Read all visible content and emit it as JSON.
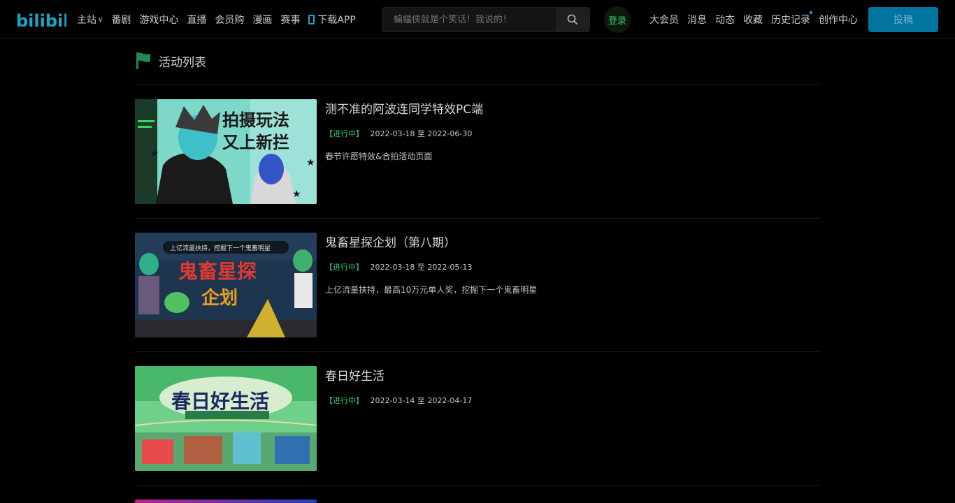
{
  "header": {
    "logo_text": "bilibili",
    "nav": [
      {
        "label": "主站"
      },
      {
        "label": "番剧"
      },
      {
        "label": "游戏中心"
      },
      {
        "label": "直播"
      },
      {
        "label": "会员购"
      },
      {
        "label": "漫画"
      },
      {
        "label": "赛事"
      },
      {
        "label": "下载APP"
      }
    ],
    "search_placeholder": "蝙蝠侠就是个笑话！我说的！",
    "login_label": "登录",
    "right_nav": [
      {
        "label": "大会员"
      },
      {
        "label": "消息"
      },
      {
        "label": "动态"
      },
      {
        "label": "收藏"
      },
      {
        "label": "历史记录"
      },
      {
        "label": "创作中心"
      }
    ],
    "post_label": "投稿"
  },
  "section": {
    "title": "活动列表"
  },
  "activities": [
    {
      "title": "测不准的阿波连同学特效PC端",
      "status": "【进行中】",
      "date_range": "2022-03-18 至 2022-06-30",
      "description": "春节许愿特效&合拍活动页面",
      "thumb_text": [
        "拍摄玩法",
        "又上新拦"
      ]
    },
    {
      "title": "鬼畜星探企划（第八期）",
      "status": "【进行中】",
      "date_range": "2022-03-18 至 2022-05-13",
      "description": "上亿流量扶持，最高10万元单人奖，挖掘下一个鬼畜明星",
      "thumb_text": [
        "上亿流量扶持，挖掘下一个鬼畜明星",
        "鬼畜星探",
        "企划"
      ]
    },
    {
      "title": "春日好生活",
      "status": "【进行中】",
      "date_range": "2022-03-14 至 2022-04-17",
      "description": "",
      "thumb_text": [
        "春日好生活"
      ]
    }
  ],
  "colors": {
    "background": "#000000",
    "accent_green": "#3ac46b",
    "accent_blue": "#29a3d6",
    "post_button": "#0174a0"
  }
}
